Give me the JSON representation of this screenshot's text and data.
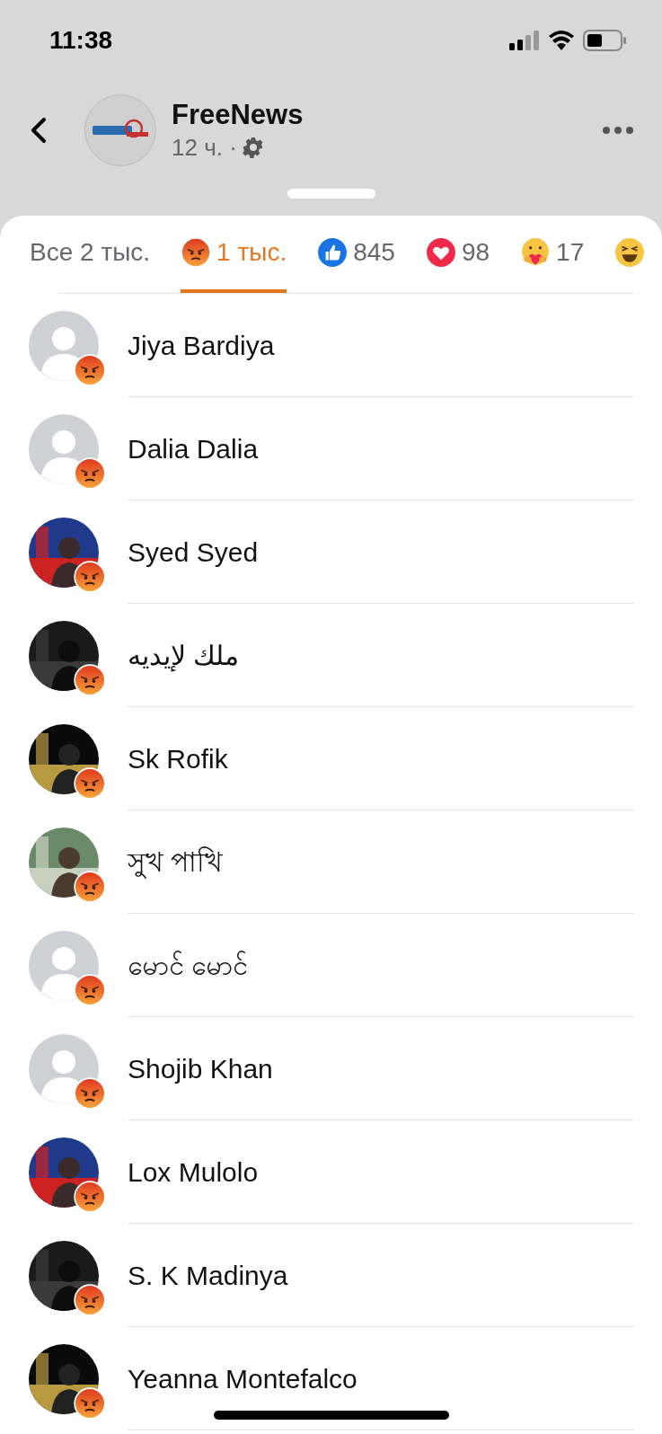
{
  "status_bar": {
    "time": "11:38"
  },
  "header": {
    "page_name": "FreeNews",
    "time_ago": "12 ч. ·"
  },
  "tabs": [
    {
      "kind": "all",
      "label": "Все 2 тыс.",
      "selected": false
    },
    {
      "kind": "angry",
      "label": "1 тыс.",
      "selected": true
    },
    {
      "kind": "like",
      "label": "845",
      "selected": false
    },
    {
      "kind": "love",
      "label": "98",
      "selected": false
    },
    {
      "kind": "care",
      "label": "17",
      "selected": false
    },
    {
      "kind": "haha",
      "selected": false
    }
  ],
  "people": [
    {
      "name": "Jiya Bardiya",
      "has_photo": false
    },
    {
      "name": "Dalia Dalia",
      "has_photo": false
    },
    {
      "name": "Syed Syed",
      "has_photo": true
    },
    {
      "name": "ملك لإيديه",
      "has_photo": true
    },
    {
      "name": "Sk Rofik",
      "has_photo": true
    },
    {
      "name": "সুখ পাখি",
      "has_photo": true
    },
    {
      "name": "မောင် မောင်",
      "has_photo": false
    },
    {
      "name": "Shojib Khan",
      "has_photo": false
    },
    {
      "name": "Lox Mulolo",
      "has_photo": true
    },
    {
      "name": "S. K Madinya",
      "has_photo": true
    },
    {
      "name": "Yeanna Montefalco",
      "has_photo": true
    }
  ]
}
